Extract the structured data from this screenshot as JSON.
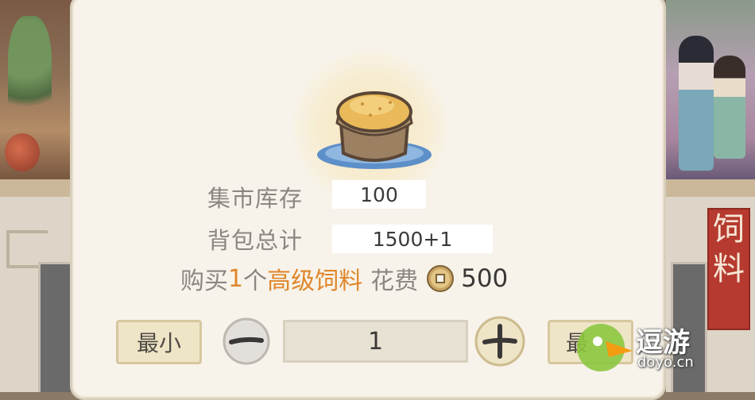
{
  "inventory": {
    "market_stock_label": "集市库存",
    "market_stock_value": "100",
    "backpack_total_label": "背包总计",
    "backpack_total_value": "1500+1"
  },
  "purchase": {
    "prefix": "购买",
    "quantity": "1",
    "measure": "个",
    "item_name": "高级饲料",
    "cost_label": "花费",
    "cost_value": "500",
    "currency_icon": "copper-coin-icon",
    "item_icon": "feed-basket-icon"
  },
  "controls": {
    "min_label": "最小",
    "max_label": "最",
    "decrement_icon": "minus-icon",
    "increment_icon": "plus-icon",
    "quantity_value": "1"
  },
  "background": {
    "banner_text": "饲料"
  },
  "watermark": {
    "title": "逗游",
    "domain": "doyo.cn"
  },
  "colors": {
    "highlight": "#e0862a",
    "label": "#8b8682",
    "panel": "#f7f3ea",
    "button": "#eee4c6"
  }
}
